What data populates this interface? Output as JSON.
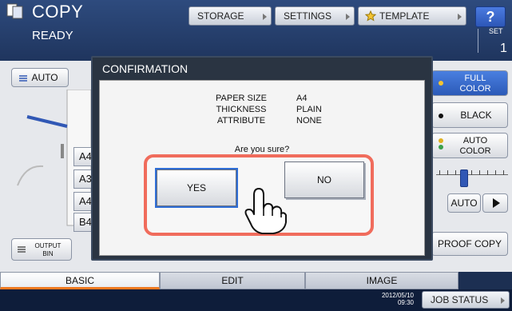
{
  "header": {
    "app_title": "COPY",
    "status": "READY",
    "tabs": [
      {
        "label": "STORAGE"
      },
      {
        "label": "SETTINGS"
      },
      {
        "label": "TEMPLATE"
      }
    ],
    "help_label": "?",
    "set": {
      "label": "SET",
      "value": "1"
    }
  },
  "left_panel": {
    "auto_label": "AUTO",
    "paper_sizes": [
      "A4",
      "A3",
      "A4",
      "B4"
    ],
    "output_bin": {
      "line1": "OUTPUT",
      "line2": "BIN"
    }
  },
  "right_panel": {
    "full_color": {
      "line1": "FULL",
      "line2": "COLOR"
    },
    "black_label": "BLACK",
    "auto_color": {
      "line1": "AUTO",
      "line2": "COLOR"
    },
    "density_auto_label": "AUTO",
    "proof_copy_label": "PROOF COPY"
  },
  "bottom_tabs": [
    {
      "label": "BASIC"
    },
    {
      "label": "EDIT"
    },
    {
      "label": "IMAGE"
    }
  ],
  "status_bar": {
    "date": "2012/05/10",
    "time": "09:30",
    "job_status_label": "JOB STATUS"
  },
  "dialog": {
    "title": "CONFIRMATION",
    "info": [
      {
        "label": "PAPER SIZE",
        "value": "A4"
      },
      {
        "label": "THICKNESS",
        "value": "PLAIN"
      },
      {
        "label": "ATTRIBUTE",
        "value": "NONE"
      }
    ],
    "question": "Are you sure?",
    "yes_label": "YES",
    "no_label": "NO"
  },
  "colors": {
    "header_bg": "#1f355e",
    "highlight": "#f06c5c",
    "accent_tab": "#f17920",
    "full_color_btn": "#2b5ab8"
  }
}
